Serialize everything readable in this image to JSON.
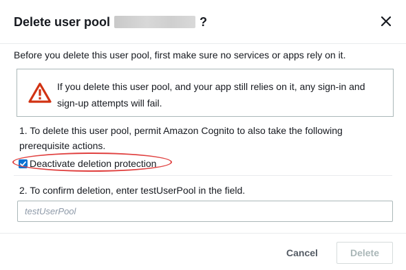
{
  "dialog": {
    "title_prefix": "Delete user pool",
    "title_suffix": "?",
    "close_icon": "close-icon"
  },
  "intro_text": "Before you delete this user pool, first make sure no services or apps rely on it.",
  "warning": {
    "icon": "warning-icon",
    "text": "If you delete this user pool, and your app still relies on it, any sign-in and sign-up attempts will fail.",
    "icon_color": "#d13212"
  },
  "step1": {
    "text": "1. To delete this user pool, permit Amazon Cognito to also take the following prerequisite actions."
  },
  "checkbox": {
    "label": "Deactivate deletion protection",
    "checked": true,
    "color": "#0972d3"
  },
  "step2": {
    "text": "2. To confirm deletion, enter testUserPool in the field."
  },
  "confirm_input": {
    "value": "",
    "placeholder": "testUserPool"
  },
  "footer": {
    "cancel_label": "Cancel",
    "delete_label": "Delete"
  },
  "annotation": {
    "highlight_color": "#e0403f"
  }
}
